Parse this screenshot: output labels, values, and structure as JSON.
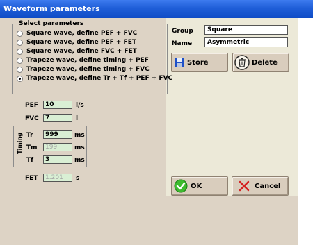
{
  "window": {
    "title": "Waveform parameters"
  },
  "select": {
    "legend": "Select parameters",
    "options": [
      {
        "label": "Square wave, define PEF + FVC",
        "checked": false
      },
      {
        "label": "Square wave, define PEF + FET",
        "checked": false
      },
      {
        "label": "Square wave, define FVC + FET",
        "checked": false
      },
      {
        "label": "Trapeze wave, define timing + PEF",
        "checked": false
      },
      {
        "label": "Trapeze wave, define timing + FVC",
        "checked": false
      },
      {
        "label": "Trapeze wave, define Tr + Tf + PEF + FVC",
        "checked": true
      }
    ]
  },
  "params": {
    "pef": {
      "label": "PEF",
      "value": "10",
      "unit": "l/s"
    },
    "fvc": {
      "label": "FVC",
      "value": "7",
      "unit": "l"
    },
    "timing_label": "Timing",
    "tr": {
      "label": "Tr",
      "value": "999",
      "unit": "ms"
    },
    "tm": {
      "label": "Tm",
      "value": "199",
      "unit": "ms"
    },
    "tf": {
      "label": "Tf",
      "value": "3",
      "unit": "ms"
    },
    "fet": {
      "label": "FET",
      "value": "1.201",
      "unit": "s"
    }
  },
  "right": {
    "group_label": "Group",
    "group_value": "Square",
    "name_label": "Name",
    "name_value": "Asymmetric",
    "store_label": "Store",
    "delete_label": "Delete",
    "ok_label": "OK",
    "cancel_label": "Cancel"
  }
}
